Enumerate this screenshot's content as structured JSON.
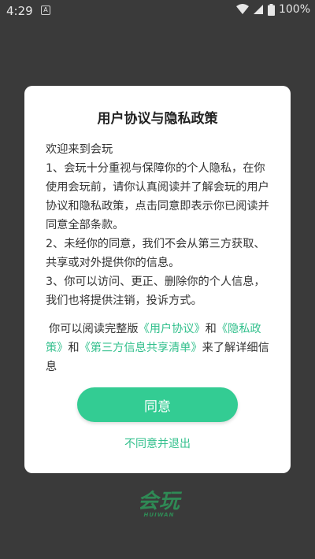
{
  "status_bar": {
    "time": "4:29",
    "notification_icon_text": "A",
    "battery_percent": "100%"
  },
  "dialog": {
    "title": "用户协议与隐私政策",
    "body": {
      "greeting": "欢迎来到会玩",
      "item1": "1、会玩十分重视与保障你的个人隐私，在你使用会玩前，请你认真阅读并了解会玩的用户协议和隐私政策，点击同意即表示你已阅读并同意全部条款。",
      "item2": "2、未经你的同意，我们不会从第三方获取、共享或对外提供你的信息。",
      "item3": "3、你可以访问、更正、删除你的个人信息，我们也将提供注销，投诉方式。"
    },
    "links_paragraph": {
      "prefix": "你可以阅读完整版",
      "user_agreement_link": "《用户协议》",
      "and1": "和",
      "privacy_policy_link": "《隐私政策》",
      "and2": "和",
      "third_party_link": "《第三方信息共享清单》",
      "suffix": "来了解详细信息"
    },
    "agree_label": "同意",
    "disagree_label": "不同意并退出"
  },
  "logo": {
    "main_text": "会玩",
    "sub_text": "HUIWAN"
  },
  "colors": {
    "accent": "#33cc93",
    "link": "#33c08d",
    "overlay_background": "#3a3a3a"
  }
}
